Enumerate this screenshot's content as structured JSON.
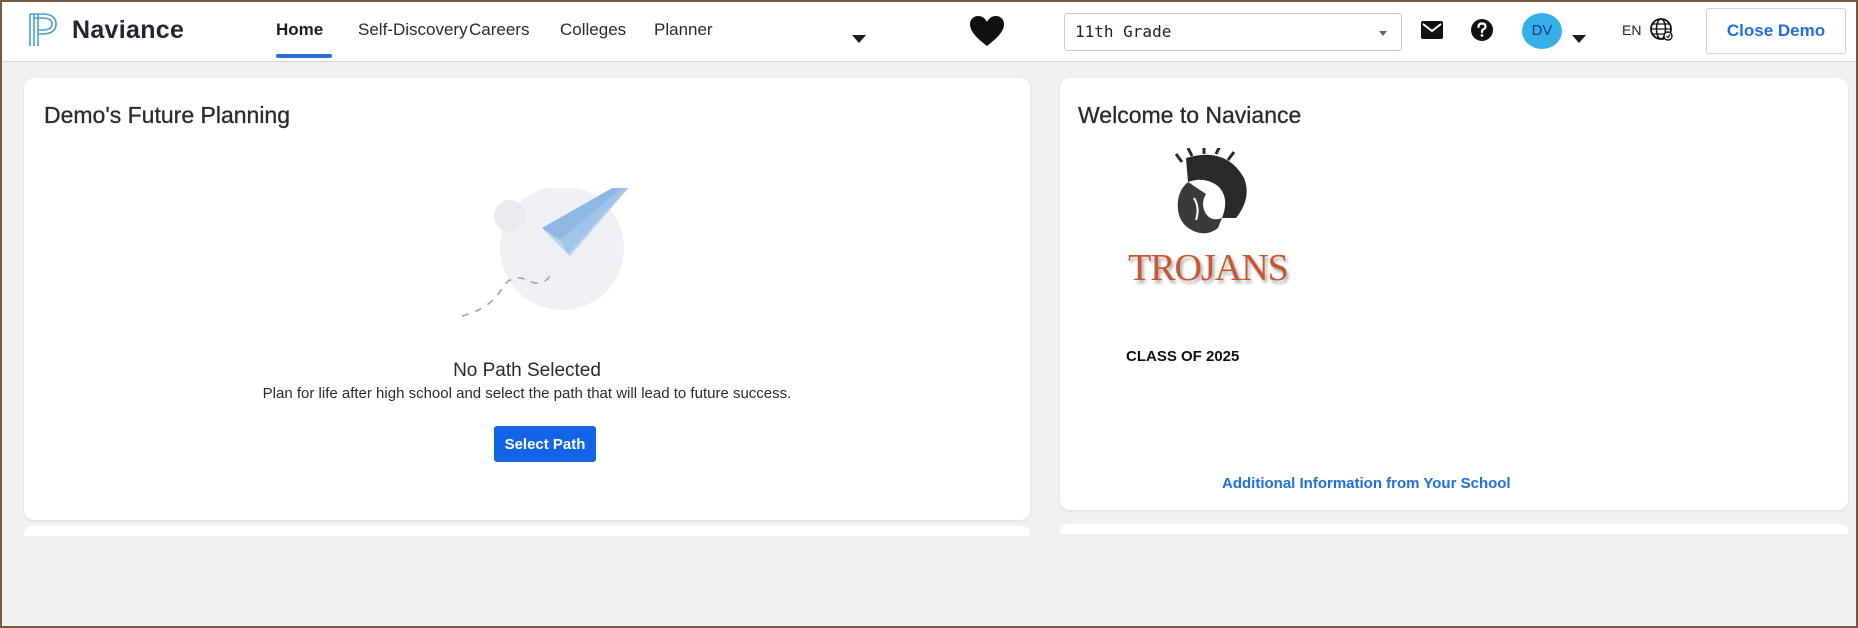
{
  "brand": {
    "name": "Naviance"
  },
  "nav": {
    "items": [
      {
        "label": "Home",
        "active": true
      },
      {
        "label": "Self-Discovery",
        "active": false
      },
      {
        "label": "Careers",
        "active": false
      },
      {
        "label": "Colleges",
        "active": false
      },
      {
        "label": "Planner",
        "active": false
      }
    ]
  },
  "header": {
    "grade_select": "11th Grade",
    "avatar_initials": "DV",
    "language": "EN",
    "close_demo_label": "Close Demo",
    "icons": [
      "heart-icon",
      "mail-icon",
      "help-icon",
      "globe-icon"
    ]
  },
  "future_planning": {
    "title": "Demo's Future Planning",
    "empty_title": "No Path Selected",
    "empty_text": "Plan for life after high school and select the path that will lead to future success.",
    "button_label": "Select Path"
  },
  "welcome": {
    "title": "Welcome to Naviance",
    "school_logo_text": "TROJANS",
    "class_text": "CLASS OF 2025",
    "link_text": "Additional Information from Your School"
  },
  "colors": {
    "accent": "#1464e8",
    "link": "#1f6fe0",
    "avatar_bg": "#36b0e8",
    "background": "#eef0f2"
  }
}
